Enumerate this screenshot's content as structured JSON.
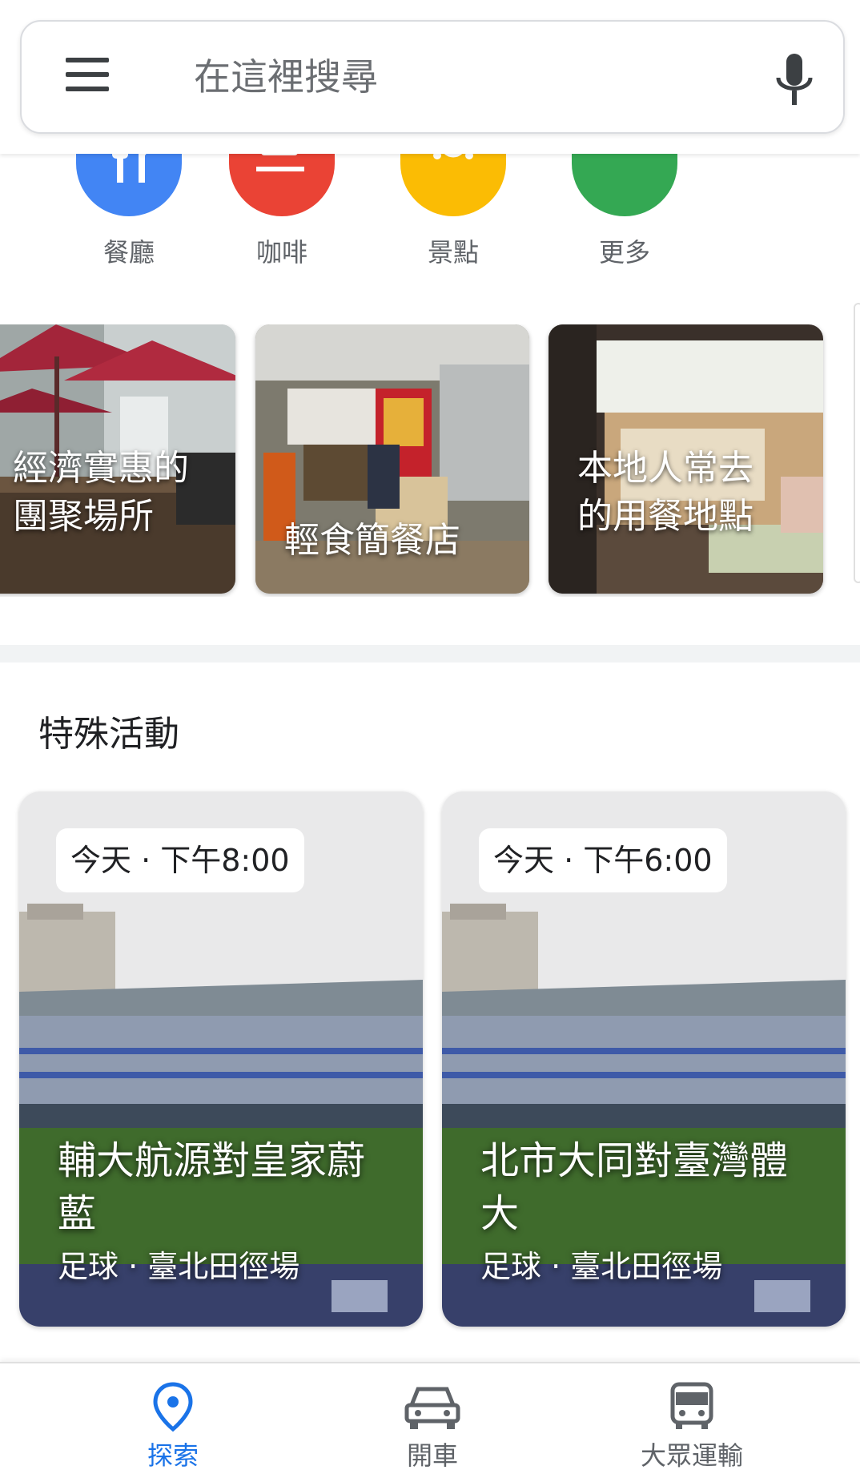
{
  "search": {
    "placeholder": "在這裡搜尋",
    "menu_icon": "hamburger-menu-icon",
    "mic_icon": "microphone-icon"
  },
  "categories": [
    {
      "label": "餐廳",
      "icon": "restaurant-icon",
      "color": "#4285f4"
    },
    {
      "label": "咖啡",
      "icon": "coffee-icon",
      "color": "#ea4335"
    },
    {
      "label": "景點",
      "icon": "attractions-icon",
      "color": "#fbbc04"
    },
    {
      "label": "更多",
      "icon": "more-dots-icon",
      "color": "#34a853"
    }
  ],
  "place_cards": [
    {
      "title_line1": "經濟實惠的",
      "title_line2": "團聚場所"
    },
    {
      "title_line1": "輕食簡餐店",
      "title_line2": ""
    },
    {
      "title_line1": "本地人常去",
      "title_line2": "的用餐地點"
    }
  ],
  "events_section": {
    "title": "特殊活動",
    "events": [
      {
        "time": "今天 · 下午8:00",
        "title_line1": "輔大航源對皇家蔚",
        "title_line2": "藍",
        "subtitle": "足球 · 臺北田徑場"
      },
      {
        "time": "今天 · 下午6:00",
        "title_line1": "北市大同對臺灣體",
        "title_line2": "大",
        "subtitle": "足球 · 臺北田徑場"
      }
    ]
  },
  "bottom_nav": {
    "items": [
      {
        "label": "探索",
        "icon": "location-pin-icon",
        "active": true
      },
      {
        "label": "開車",
        "icon": "car-icon",
        "active": false
      },
      {
        "label": "大眾運輸",
        "icon": "bus-icon",
        "active": false
      }
    ],
    "active_color": "#1a73e8"
  }
}
